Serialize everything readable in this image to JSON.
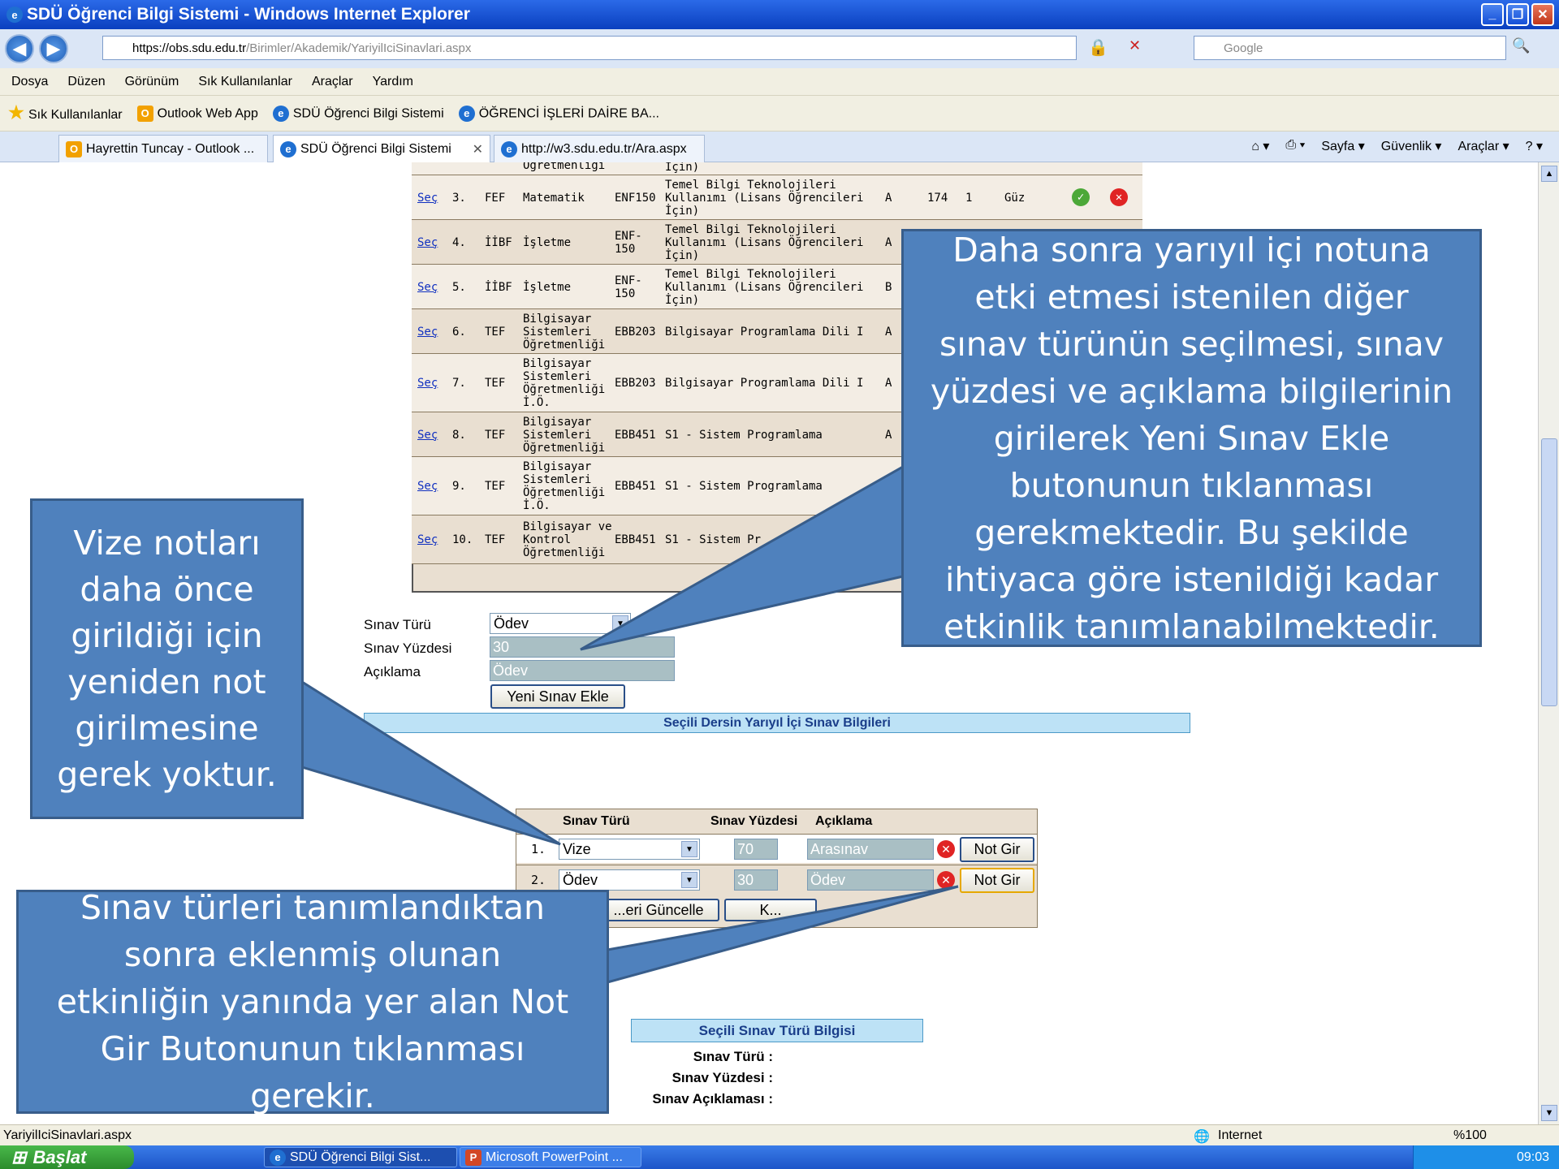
{
  "window": {
    "title": "SDÜ Öğrenci Bilgi Sistemi - Windows Internet Explorer"
  },
  "address": {
    "scheme": "https://",
    "domain": "obs.sdu.edu.tr",
    "path": "/Birimler/Akademik/YariyilIciSinavlari.aspx",
    "search_placeholder": "Google"
  },
  "menu": [
    "Dosya",
    "Düzen",
    "Görünüm",
    "Sık Kullanılanlar",
    "Araçlar",
    "Yardım"
  ],
  "favorites": {
    "label": "Sık Kullanılanlar",
    "items": [
      "Outlook Web App",
      "SDÜ Öğrenci Bilgi Sistemi",
      "ÖĞRENCİ İŞLERİ DAİRE BA..."
    ]
  },
  "tabs": [
    "Hayrettin Tuncay - Outlook ...",
    "SDÜ Öğrenci Bilgi Sistemi",
    "http://w3.sdu.edu.tr/Ara.aspx"
  ],
  "commands": [
    "Sayfa ▾",
    "Güvenlik ▾",
    "Araçlar ▾"
  ],
  "courses": {
    "top_fragment": {
      "dept": "Öğretmenliği",
      "name": "İçin)"
    },
    "rows": [
      {
        "link": "Seç",
        "no": "3.",
        "fac": "FEF",
        "dept": [
          "Matematik"
        ],
        "code": [
          "ENF150"
        ],
        "name": [
          "Temel Bilgi Teknolojileri",
          "Kullanımı (Lisans Öğrencileri",
          "İçin)"
        ],
        "grp": "A",
        "count": "174",
        "x": "1",
        "term": "Güz"
      },
      {
        "link": "Seç",
        "no": "4.",
        "fac": "İİBF",
        "dept": [
          "İşletme"
        ],
        "code": [
          "ENF-",
          "150"
        ],
        "name": [
          "Temel Bilgi Teknolojileri",
          "Kullanımı (Lisans Öğrencileri",
          "İçin)"
        ],
        "grp": "A"
      },
      {
        "link": "Seç",
        "no": "5.",
        "fac": "İİBF",
        "dept": [
          "İşletme"
        ],
        "code": [
          "ENF-",
          "150"
        ],
        "name": [
          "Temel Bilgi Teknolojileri",
          "Kullanımı (Lisans Öğrencileri",
          "İçin)"
        ],
        "grp": "B"
      },
      {
        "link": "Seç",
        "no": "6.",
        "fac": "TEF",
        "dept": [
          "Bilgisayar",
          "Sistemleri",
          "Öğretmenliği"
        ],
        "code": [
          "EBB203"
        ],
        "name": [
          "Bilgisayar Programlama Dili I"
        ],
        "grp": "A"
      },
      {
        "link": "Seç",
        "no": "7.",
        "fac": "TEF",
        "dept": [
          "Bilgisayar",
          "Sistemleri",
          "Öğretmenliği",
          "İ.Ö."
        ],
        "code": [
          "EBB203"
        ],
        "name": [
          "Bilgisayar Programlama Dili I"
        ],
        "grp": "A"
      },
      {
        "link": "Seç",
        "no": "8.",
        "fac": "TEF",
        "dept": [
          "Bilgisayar",
          "Sistemleri",
          "Öğretmenliği"
        ],
        "code": [
          "EBB451"
        ],
        "name": [
          "S1 - Sistem Programlama"
        ],
        "grp": "A"
      },
      {
        "link": "Seç",
        "no": "9.",
        "fac": "TEF",
        "dept": [
          "Bilgisayar",
          "Sistemleri",
          "Öğretmenliği",
          "İ.Ö."
        ],
        "code": [
          "EBB451"
        ],
        "name": [
          "S1 - Sistem Programlama"
        ],
        "grp": ""
      },
      {
        "link": "Seç",
        "no": "10.",
        "fac": "TEF",
        "dept": [
          "Bilgisayar ve",
          "Kontrol",
          "Öğretmenliği"
        ],
        "code": [
          "EBB451"
        ],
        "name": [
          "S1 - Sistem Pr"
        ],
        "grp": ""
      }
    ]
  },
  "form": {
    "type_label": "Sınav Türü",
    "type_value": "Ödev",
    "percent_label": "Sınav Yüzdesi",
    "percent_value": "30",
    "desc_label": "Açıklama",
    "desc_value": "Ödev",
    "add_button": "Yeni Sınav Ekle"
  },
  "selected_header": "Seçili Dersin Yarıyıl İçi Sınav Bilgileri",
  "exams": {
    "headers": [
      "Sınav Türü",
      "Sınav Yüzdesi",
      "Açıklama"
    ],
    "rows": [
      {
        "no": "1.",
        "type": "Vize",
        "percent": "70",
        "desc": "Arasınav",
        "button": "Not Gir"
      },
      {
        "no": "2.",
        "type": "Ödev",
        "percent": "30",
        "desc": "Ödev",
        "button": "Not Gir"
      }
    ],
    "update_button": "...eri Güncelle",
    "second_button": "K..."
  },
  "info": {
    "header": "Seçili Sınav Türü Bilgisi",
    "labels": [
      "Sınav Türü :",
      "Sınav Yüzdesi :",
      "Sınav Açıklaması :"
    ]
  },
  "callouts": {
    "right": "Daha sonra yarıyıl içi notuna etki etmesi istenilen diğer sınav türünün seçilmesi, sınav yüzdesi ve açıklama bilgilerinin girilerek Yeni Sınav Ekle butonunun tıklanması gerekmektedir. Bu şekilde ihtiyaca göre istenildiği kadar etkinlik tanımlanabilmektedir.",
    "left": "Vize notları daha önce girildiği için yeniden not girilmesine gerek yoktur.",
    "bottom": "Sınav türleri tanımlandıktan sonra eklenmiş olunan etkinliğin yanında yer alan Not Gir Butonunun tıklanması gerekir."
  },
  "status": {
    "url": "YariyilIciSinavlari.aspx",
    "zone": "Internet",
    "zoom": "%100"
  },
  "taskbar": {
    "start": "Başlat",
    "tasks": [
      "SDÜ Öğrenci Bilgi Sist...",
      "Microsoft PowerPoint ..."
    ],
    "clock": "09:03"
  },
  "colors": {
    "callout": "#4f81bd",
    "row_light": "#f3ede4",
    "row_dark": "#e9dfd1",
    "header_blue": "#bde2f6"
  }
}
